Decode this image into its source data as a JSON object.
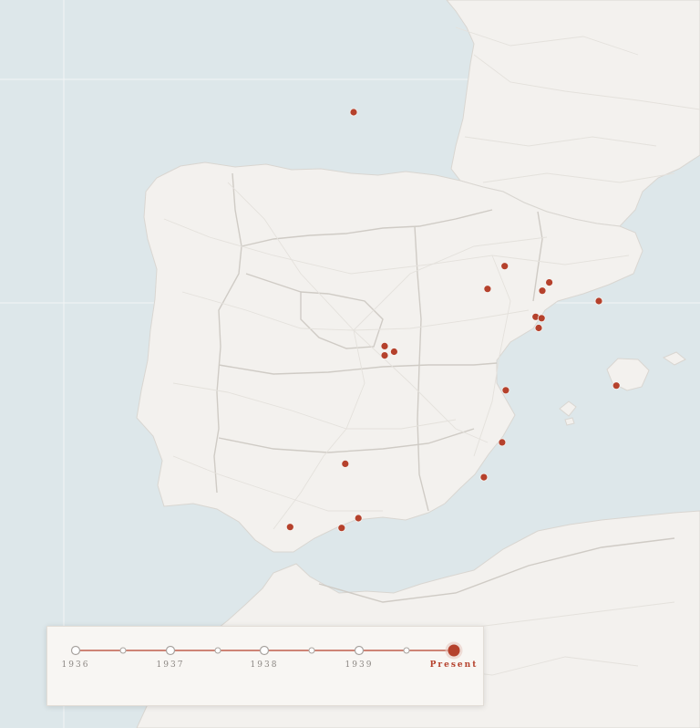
{
  "timeline": {
    "years": [
      "1936",
      "1937",
      "1938",
      "1939",
      "Present"
    ],
    "active": "Present"
  },
  "colors": {
    "sea": "#dde7ea",
    "land": "#f3f1ee",
    "marker": "#b5412c",
    "timeline_line": "#b5412c"
  },
  "markers": [
    {
      "place": "Bay of Biscay",
      "lat": 45.45,
      "lon": -4.55
    },
    {
      "place": "Huesca",
      "lat": 42.14,
      "lon": -0.41
    },
    {
      "place": "Zaragoza",
      "lat": 41.65,
      "lon": -0.88
    },
    {
      "place": "Lleida",
      "lat": 41.61,
      "lon": 0.62
    },
    {
      "place": "Balaguer",
      "lat": 41.79,
      "lon": 0.81
    },
    {
      "place": "Barcelona",
      "lat": 41.39,
      "lon": 2.17
    },
    {
      "place": "Gandesa",
      "lat": 41.05,
      "lon": 0.44
    },
    {
      "place": "Ebro",
      "lat": 41.02,
      "lon": 0.6
    },
    {
      "place": "Tortosa",
      "lat": 40.81,
      "lon": 0.52
    },
    {
      "place": "Madrid",
      "lat": 40.42,
      "lon": -3.7
    },
    {
      "place": "Jarama",
      "lat": 40.22,
      "lon": -3.7
    },
    {
      "place": "Arganda",
      "lat": 40.3,
      "lon": -3.44
    },
    {
      "place": "Valencia",
      "lat": 39.47,
      "lon": -0.38
    },
    {
      "place": "Palma",
      "lat": 39.57,
      "lon": 2.65
    },
    {
      "place": "Alicante",
      "lat": 38.35,
      "lon": -0.48
    },
    {
      "place": "Cartagena",
      "lat": 37.6,
      "lon": -0.98
    },
    {
      "place": "Córdoba",
      "lat": 37.89,
      "lon": -4.78
    },
    {
      "place": "Málaga",
      "lat": 36.72,
      "lon": -4.42
    },
    {
      "place": "Marbella",
      "lat": 36.51,
      "lon": -4.88
    },
    {
      "place": "Cádiz",
      "lat": 36.53,
      "lon": -6.29
    }
  ]
}
